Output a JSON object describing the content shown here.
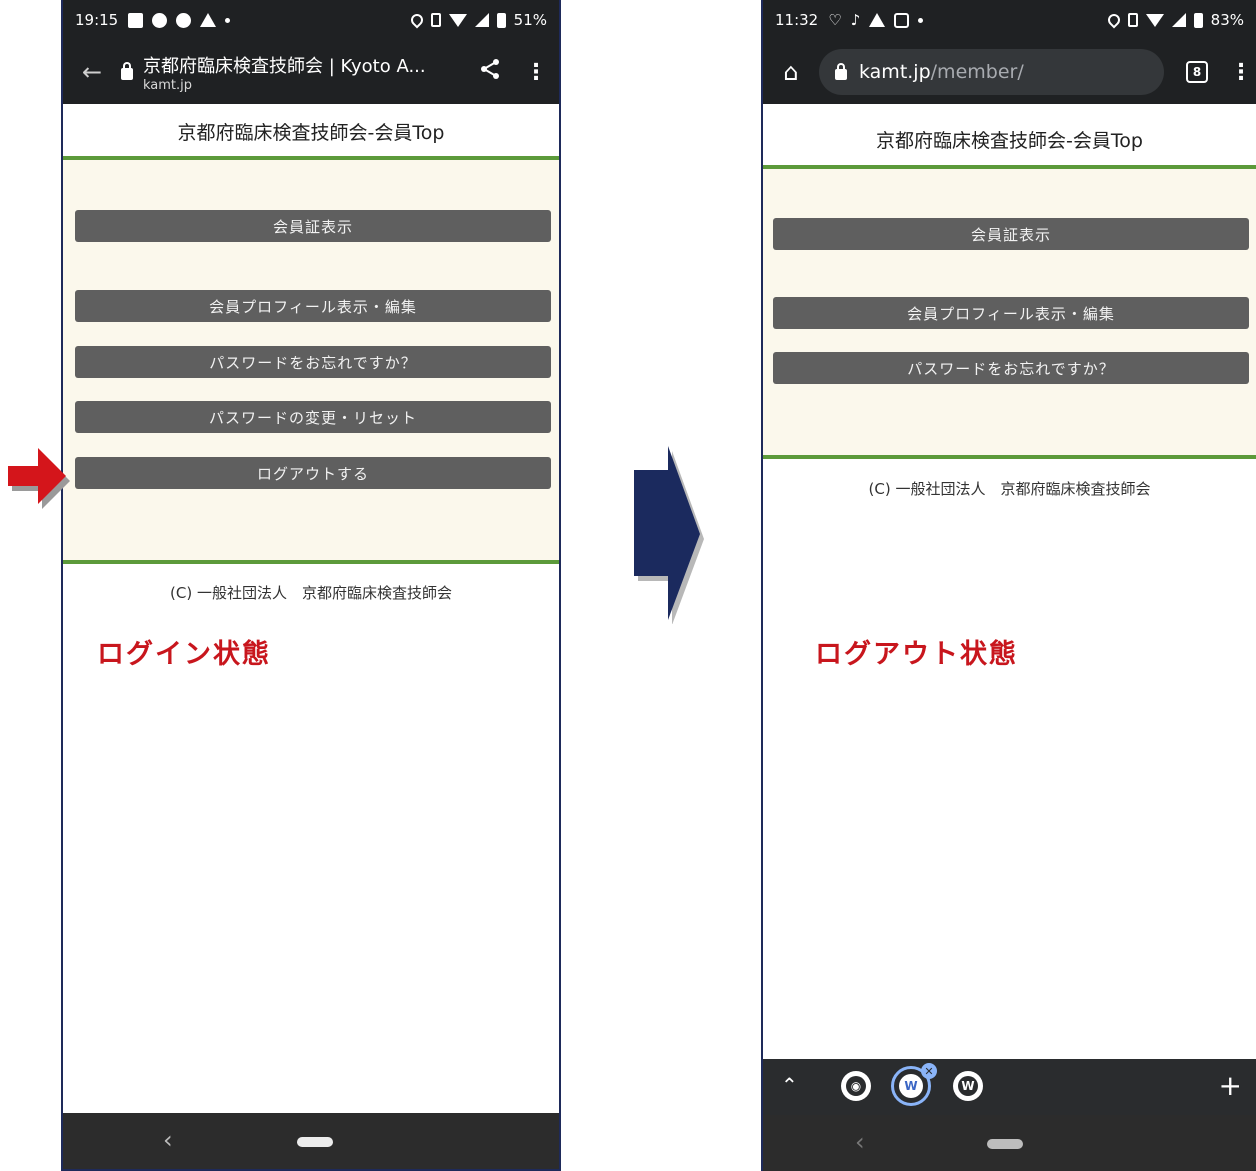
{
  "left": {
    "status": {
      "time": "19:15",
      "battery": "51%"
    },
    "toolbar": {
      "page_title": "京都府臨床検査技師会 | Kyoto A...",
      "domain": "kamt.jp"
    },
    "header_title": "京都府臨床検査技師会-会員Top",
    "buttons": [
      "会員証表示",
      "会員プロフィール表示・編集",
      "パスワードをお忘れですか？",
      "パスワードの変更・リセット",
      "ログアウトする"
    ],
    "footer": "(C) 一般社団法人　京都府臨床検査技師会",
    "state_label": "ログイン状態"
  },
  "right": {
    "status": {
      "time": "11:32",
      "battery": "83%"
    },
    "toolbar": {
      "url_host": "kamt.jp",
      "url_path": "/member/",
      "tab_count": "8"
    },
    "header_title": "京都府臨床検査技師会-会員Top",
    "buttons": [
      "会員証表示",
      "会員プロフィール表示・編集",
      "パスワードをお忘れですか？"
    ],
    "footer": "(C) 一般社団法人　京都府臨床検査技師会",
    "state_label": "ログアウト状態"
  },
  "icons": {
    "back": "←",
    "share": "share-icon",
    "menu": "⋮",
    "home": "⌂",
    "chevron_up": "⌃",
    "plus": "+",
    "nav_back": "‹"
  },
  "colors": {
    "accent_green": "#5c9a3a",
    "highlight_red": "#c8161d",
    "arrow_navy": "#1b2a5e",
    "cream_bg": "#fbf8ec"
  }
}
